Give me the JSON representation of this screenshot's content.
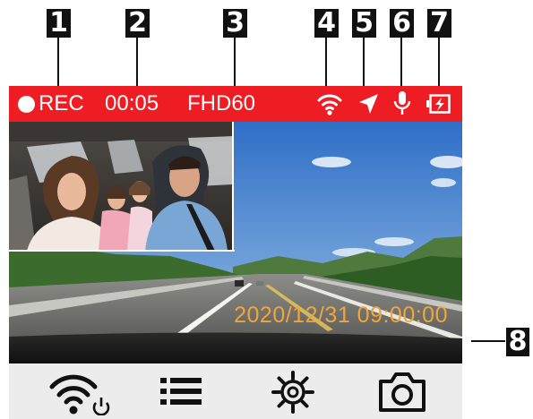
{
  "callouts": [
    "1",
    "2",
    "3",
    "4",
    "5",
    "6",
    "7",
    "8"
  ],
  "status_bar": {
    "rec_label": "REC",
    "elapsed_time": "00:05",
    "resolution": "FHD60"
  },
  "icons": {
    "rec_dot": "record-dot-icon",
    "wifi": "wifi-icon",
    "gps": "gps-arrow-icon",
    "mic": "microphone-icon",
    "battery": "battery-charging-icon",
    "wifi_power": "wifi-power-icon",
    "menu": "menu-list-icon",
    "settings": "settings-gear-icon",
    "camera": "camera-snapshot-icon"
  },
  "overlay": {
    "timestamp": "2020/12/31  09:00:00"
  },
  "colors": {
    "status_bar": "#ee1d23",
    "timestamp": "#f2a53a",
    "callout_bg": "#111111"
  }
}
